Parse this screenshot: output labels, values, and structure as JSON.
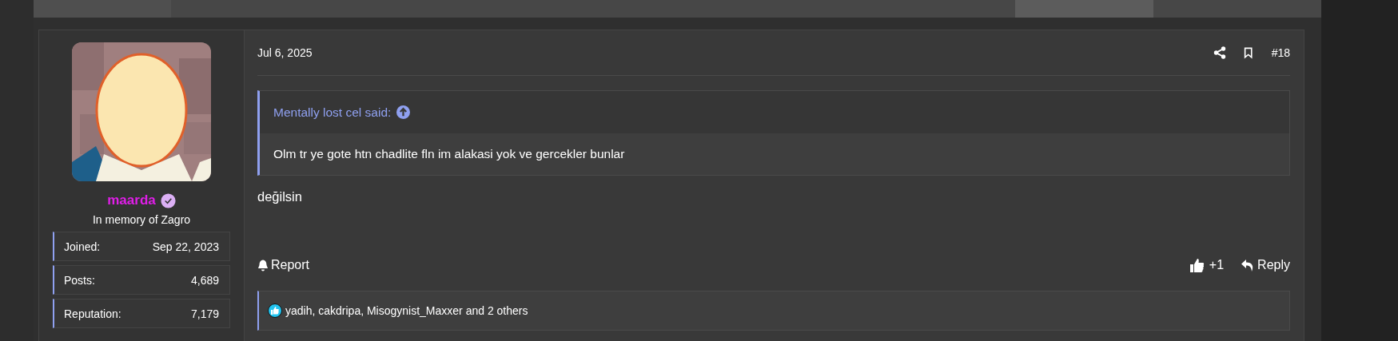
{
  "user": {
    "name": "maarda",
    "verified": true,
    "title": "In memory of Zagro",
    "stats": [
      {
        "label": "Joined:",
        "value": "Sep 22, 2023"
      },
      {
        "label": "Posts:",
        "value": "4,689"
      },
      {
        "label": "Reputation:",
        "value": "7,179"
      }
    ]
  },
  "post": {
    "date": "Jul 6, 2025",
    "number": "#18",
    "quote": {
      "author": "Mentally lost cel said:",
      "text": "Olm tr ye gote htn chadlite fln im alakasi yok ve gercekler bunlar"
    },
    "message": "değilsin",
    "actions": {
      "report": "Report",
      "like_count": "+1",
      "reply": "Reply"
    },
    "reactions": "yadih, cakdripa, Misogynist_Maxxer and 2 others"
  }
}
